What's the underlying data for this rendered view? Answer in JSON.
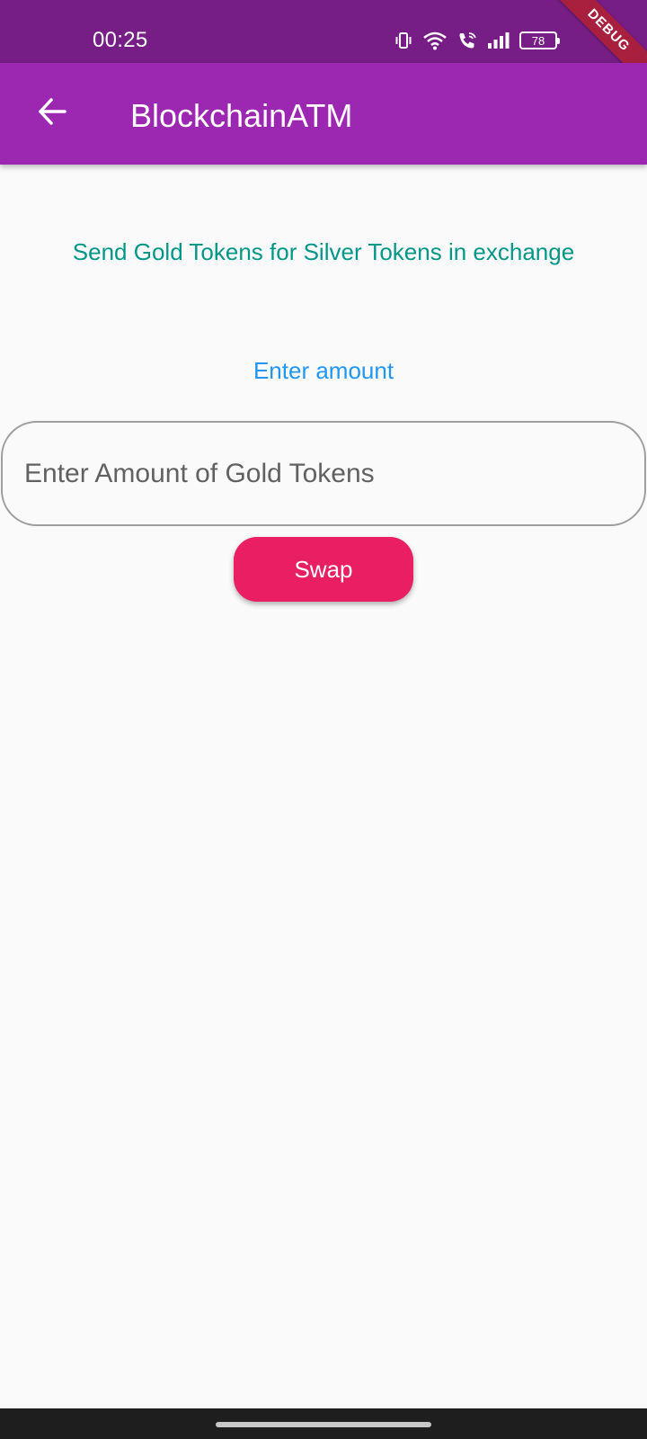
{
  "status_bar": {
    "time": "00:25",
    "battery_level": "78",
    "icons": [
      "vibrate-icon",
      "wifi-icon",
      "wifi-calling-icon",
      "signal-icon",
      "battery-icon"
    ]
  },
  "debug_banner": {
    "label": "DEBUG"
  },
  "app_bar": {
    "title": "BlockchainATM",
    "back_icon": "arrow-back-icon"
  },
  "content": {
    "subtitle": "Send Gold Tokens for Silver Tokens in exchange",
    "amount_label": "Enter amount",
    "amount_input": {
      "value": "",
      "placeholder": "Enter Amount of Gold Tokens"
    },
    "swap_button": "Swap"
  },
  "colors": {
    "status_bar": "#761d86",
    "app_bar": "#9c27b0",
    "subtitle": "#009688",
    "label": "#2196f3",
    "button": "#e91e63",
    "background": "#fafafa"
  }
}
